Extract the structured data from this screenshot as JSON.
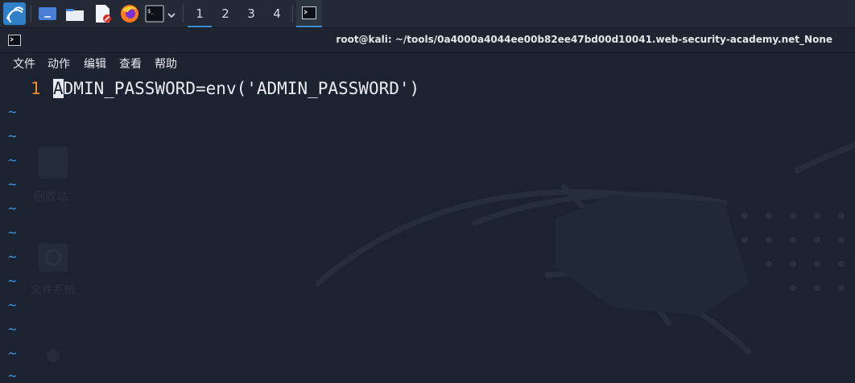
{
  "panel": {
    "workspaces": [
      "1",
      "2",
      "3",
      "4"
    ],
    "active_workspace": "1"
  },
  "window": {
    "title": "root@kali: ~/tools/0a4000a4044ee00b82ee47bd00d10041.web-security-academy.net_None"
  },
  "menu": {
    "items": [
      "文件",
      "动作",
      "编辑",
      "查看",
      "帮助"
    ]
  },
  "editor": {
    "line_number": "1",
    "cursor_char": "A",
    "line_rest": "DMIN_PASSWORD=env('ADMIN_PASSWORD')",
    "empty_marker": "~"
  },
  "desktop_ghost": {
    "trash_label": "回收站",
    "filesystem_label": "文件系统"
  },
  "colors": {
    "accent": "#3d8fd1",
    "line_number": "#f28c28",
    "text": "#e8ecf1",
    "background": "#1b2230"
  }
}
